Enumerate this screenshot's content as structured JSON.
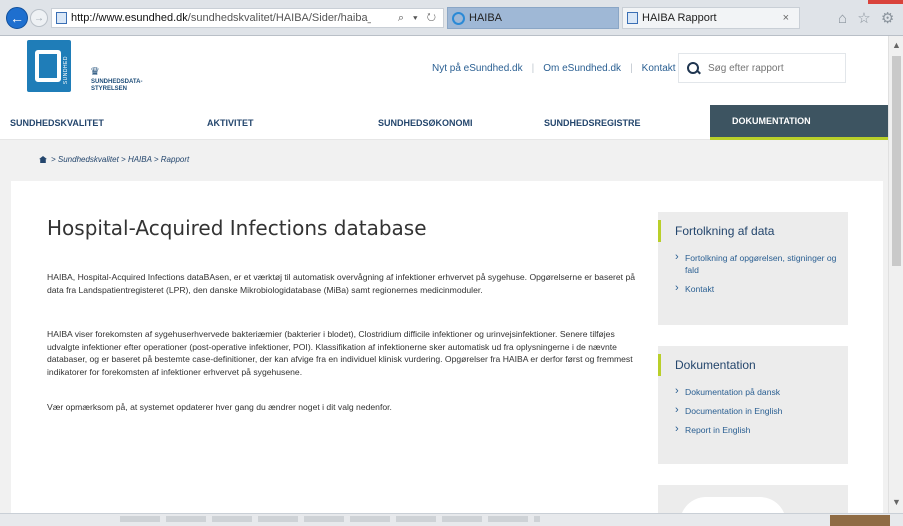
{
  "browser": {
    "url_host": "http://www.esundhed.dk",
    "url_path": "/sundhedskvalitet/HAIBA/Sider/haiba_rapport.asj",
    "address_actions": "⌕ ▾ ↻",
    "tabs": [
      {
        "label": "HAIBA",
        "active": false
      },
      {
        "label": "HAIBA Rapport",
        "active": true,
        "close": "×"
      }
    ],
    "toolbar_icons": "⌂ ☆ ⚙"
  },
  "header": {
    "logo_side_text": "SUNDHED",
    "logo_text_line1": "SUNDHEDSDATA-",
    "logo_text_line2": "STYRELSEN",
    "topnav": [
      "Nyt på eSundhed.dk",
      "Om eSundhed.dk",
      "Kontakt"
    ],
    "search_placeholder": "Søg efter rapport"
  },
  "mainnav": [
    "SUNDHEDSKVALITET",
    "AKTIVITET",
    "SUNDHEDSØKONOMI",
    "SUNDHEDSREGISTRE",
    "DOKUMENTATION"
  ],
  "breadcrumb": "> Sundhedskvalitet > HAIBA > Rapport",
  "main": {
    "title": "Hospital-Acquired Infections database",
    "paragraphs": [
      "HAIBA, Hospital-Acquired Infections dataBAsen, er et værktøj til automatisk overvågning af infektioner erhvervet på sygehuse. Opgørelserne er baseret på data fra Landspatientregisteret (LPR), den danske Mikrobiologidatabase (MiBa) samt regionernes medicinmoduler.",
      "HAIBA viser forekomsten af sygehuserhvervede bakteriæmier (bakterier i blodet), Clostridium difficile infektioner og urinvejsinfektioner. Senere tilføjes udvalgte infektioner efter operationer (post-operative infektioner, POI). Klassifikation af infektionerne sker automatisk ud fra oplysningerne i de nævnte databaser, og er baseret på bestemte case-definitioner, der kan afvige fra en individuel klinisk vurdering. Opgørelser fra HAIBA er derfor først og fremmest indikatorer for forekomsten af infektioner erhvervet på sygehusene.",
      "Vær opmærksom på, at systemet opdaterer hver gang du ændrer noget i dit valg nedenfor."
    ]
  },
  "sidebar": {
    "box1": {
      "title": "Fortolkning af data",
      "links": [
        "Fortolkning af opgørelsen, stigninger og fald",
        "Kontakt"
      ]
    },
    "box2": {
      "title": "Dokumentation",
      "links": [
        "Dokumentation på dansk",
        "Documentation in English",
        "Report in English"
      ]
    }
  },
  "colors": {
    "brand_blue": "#1f7db8",
    "nav_text": "#24466d",
    "active_nav_bg": "#3d5461",
    "accent_green": "#b9cf2a"
  }
}
